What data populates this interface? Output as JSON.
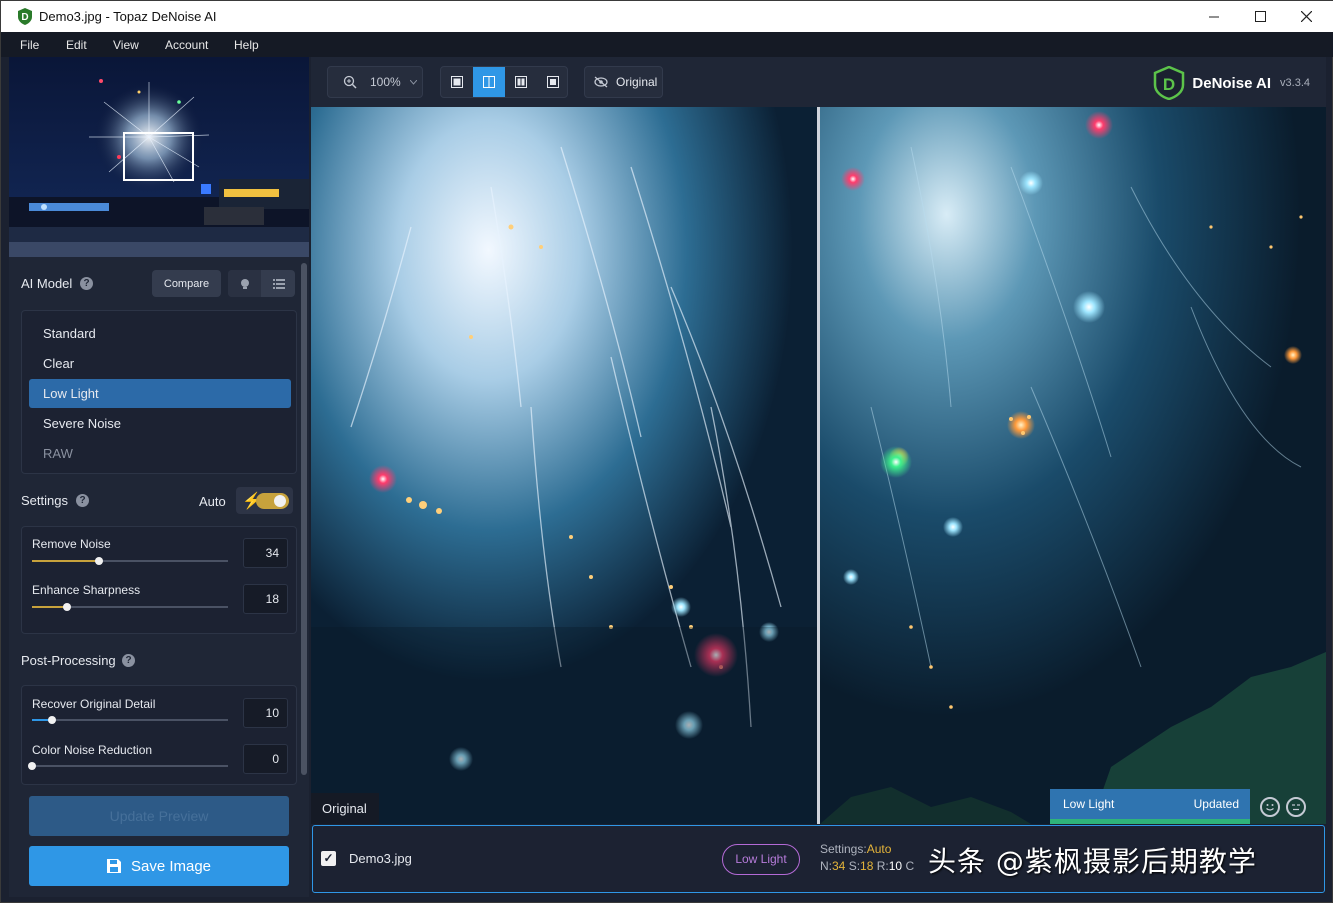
{
  "window": {
    "title": "Demo3.jpg - Topaz DeNoise AI"
  },
  "menu": {
    "items": [
      {
        "label": "File"
      },
      {
        "label": "Edit"
      },
      {
        "label": "View"
      },
      {
        "label": "Account"
      },
      {
        "label": "Help"
      }
    ]
  },
  "ai_model": {
    "heading": "AI Model",
    "compare_label": "Compare",
    "models": [
      {
        "label": "Standard",
        "state": "normal"
      },
      {
        "label": "Clear",
        "state": "normal"
      },
      {
        "label": "Low Light",
        "state": "selected"
      },
      {
        "label": "Severe Noise",
        "state": "normal"
      },
      {
        "label": "RAW",
        "state": "disabled"
      }
    ]
  },
  "settings": {
    "heading": "Settings",
    "auto_label": "Auto",
    "auto_on": true,
    "sliders": [
      {
        "label": "Remove Noise",
        "value": "34",
        "fraction": 0.34
      },
      {
        "label": "Enhance Sharpness",
        "value": "18",
        "fraction": 0.18
      }
    ]
  },
  "post_processing": {
    "heading": "Post-Processing",
    "sliders": [
      {
        "label": "Recover Original Detail",
        "value": "10",
        "fraction": 0.1
      },
      {
        "label": "Color Noise Reduction",
        "value": "0",
        "fraction": 0.0
      }
    ]
  },
  "actions": {
    "update_preview": "Update Preview",
    "save_image": "Save Image"
  },
  "toolbar": {
    "zoom": "100%",
    "original_toggle": "Original",
    "active_layout": "split"
  },
  "brand": {
    "name": "DeNoise AI",
    "version": "v3.3.4"
  },
  "viewer": {
    "original_tag": "Original",
    "processed_model": "Low Light",
    "processed_status": "Updated"
  },
  "file": {
    "name": "Demo3.jpg",
    "checked": true,
    "model": "Low Light",
    "settings_label": "Settings:",
    "settings_value": "Auto",
    "n_label": "N:",
    "n_value": "34",
    "s_label": "S:",
    "s_value": "18",
    "r_label": "R:",
    "r_value": "10",
    "c_label": "C"
  },
  "watermark": "头条 @紫枫摄影后期教学",
  "colors": {
    "accent": "#2f97e6",
    "selected_model": "#2c6aa8",
    "slider_fill": "#c7a23c",
    "model_pill": "#b46ad6",
    "updated_bar": "#2fb57a"
  }
}
